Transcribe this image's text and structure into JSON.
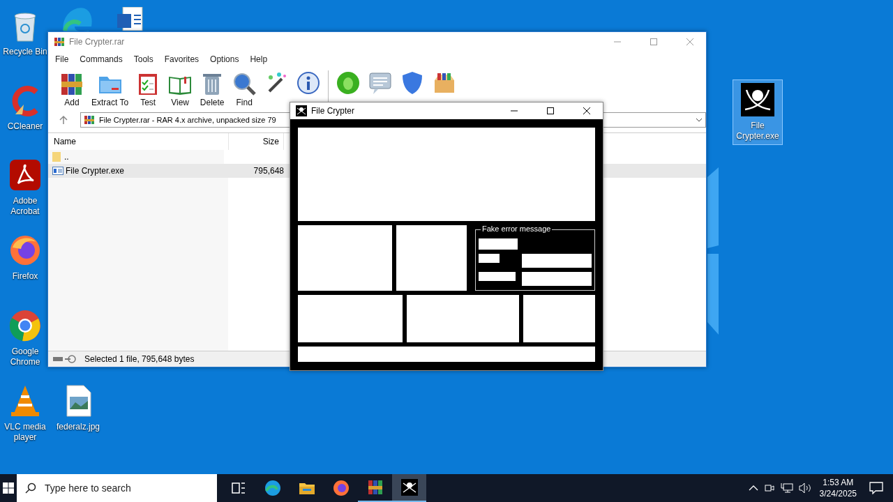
{
  "desktop_icons": [
    {
      "label": "Recycle Bin",
      "selected": false
    },
    {
      "label": "CCleaner",
      "selected": false
    },
    {
      "label": "Adobe Acrobat",
      "selected": false
    },
    {
      "label": "Firefox",
      "selected": false
    },
    {
      "label": "Google Chrome",
      "selected": false
    },
    {
      "label": "VLC media player",
      "selected": false
    },
    {
      "label": "federalz.jpg",
      "selected": false
    },
    {
      "label": "File Crypter.exe",
      "selected": true
    }
  ],
  "winrar": {
    "title": "File Crypter.rar",
    "menu": [
      "File",
      "Commands",
      "Tools",
      "Favorites",
      "Options",
      "Help"
    ],
    "toolbar": [
      "Add",
      "Extract To",
      "Test",
      "View",
      "Delete",
      "Find"
    ],
    "address": "File Crypter.rar - RAR 4.x archive, unpacked size 79",
    "columns": [
      "Name",
      "Size"
    ],
    "rows": [
      {
        "kind": "folder",
        "name": "..",
        "selected": false
      },
      {
        "kind": "exe",
        "name": "File Crypter.exe",
        "size": "795,648",
        "selected": true
      }
    ],
    "status": "Selected 1 file, 795,648 bytes"
  },
  "crypter": {
    "title": "File Crypter",
    "group_title": "Fake error message"
  },
  "taskbar": {
    "search_placeholder": "Type here to search",
    "apps": [
      {
        "running": false,
        "selected": false
      },
      {
        "running": false,
        "selected": false
      },
      {
        "running": false,
        "selected": false
      },
      {
        "running": false,
        "selected": false
      },
      {
        "running": true,
        "selected": false
      },
      {
        "running": true,
        "selected": true
      }
    ],
    "time": "1:53 AM",
    "date": "3/24/2025"
  }
}
